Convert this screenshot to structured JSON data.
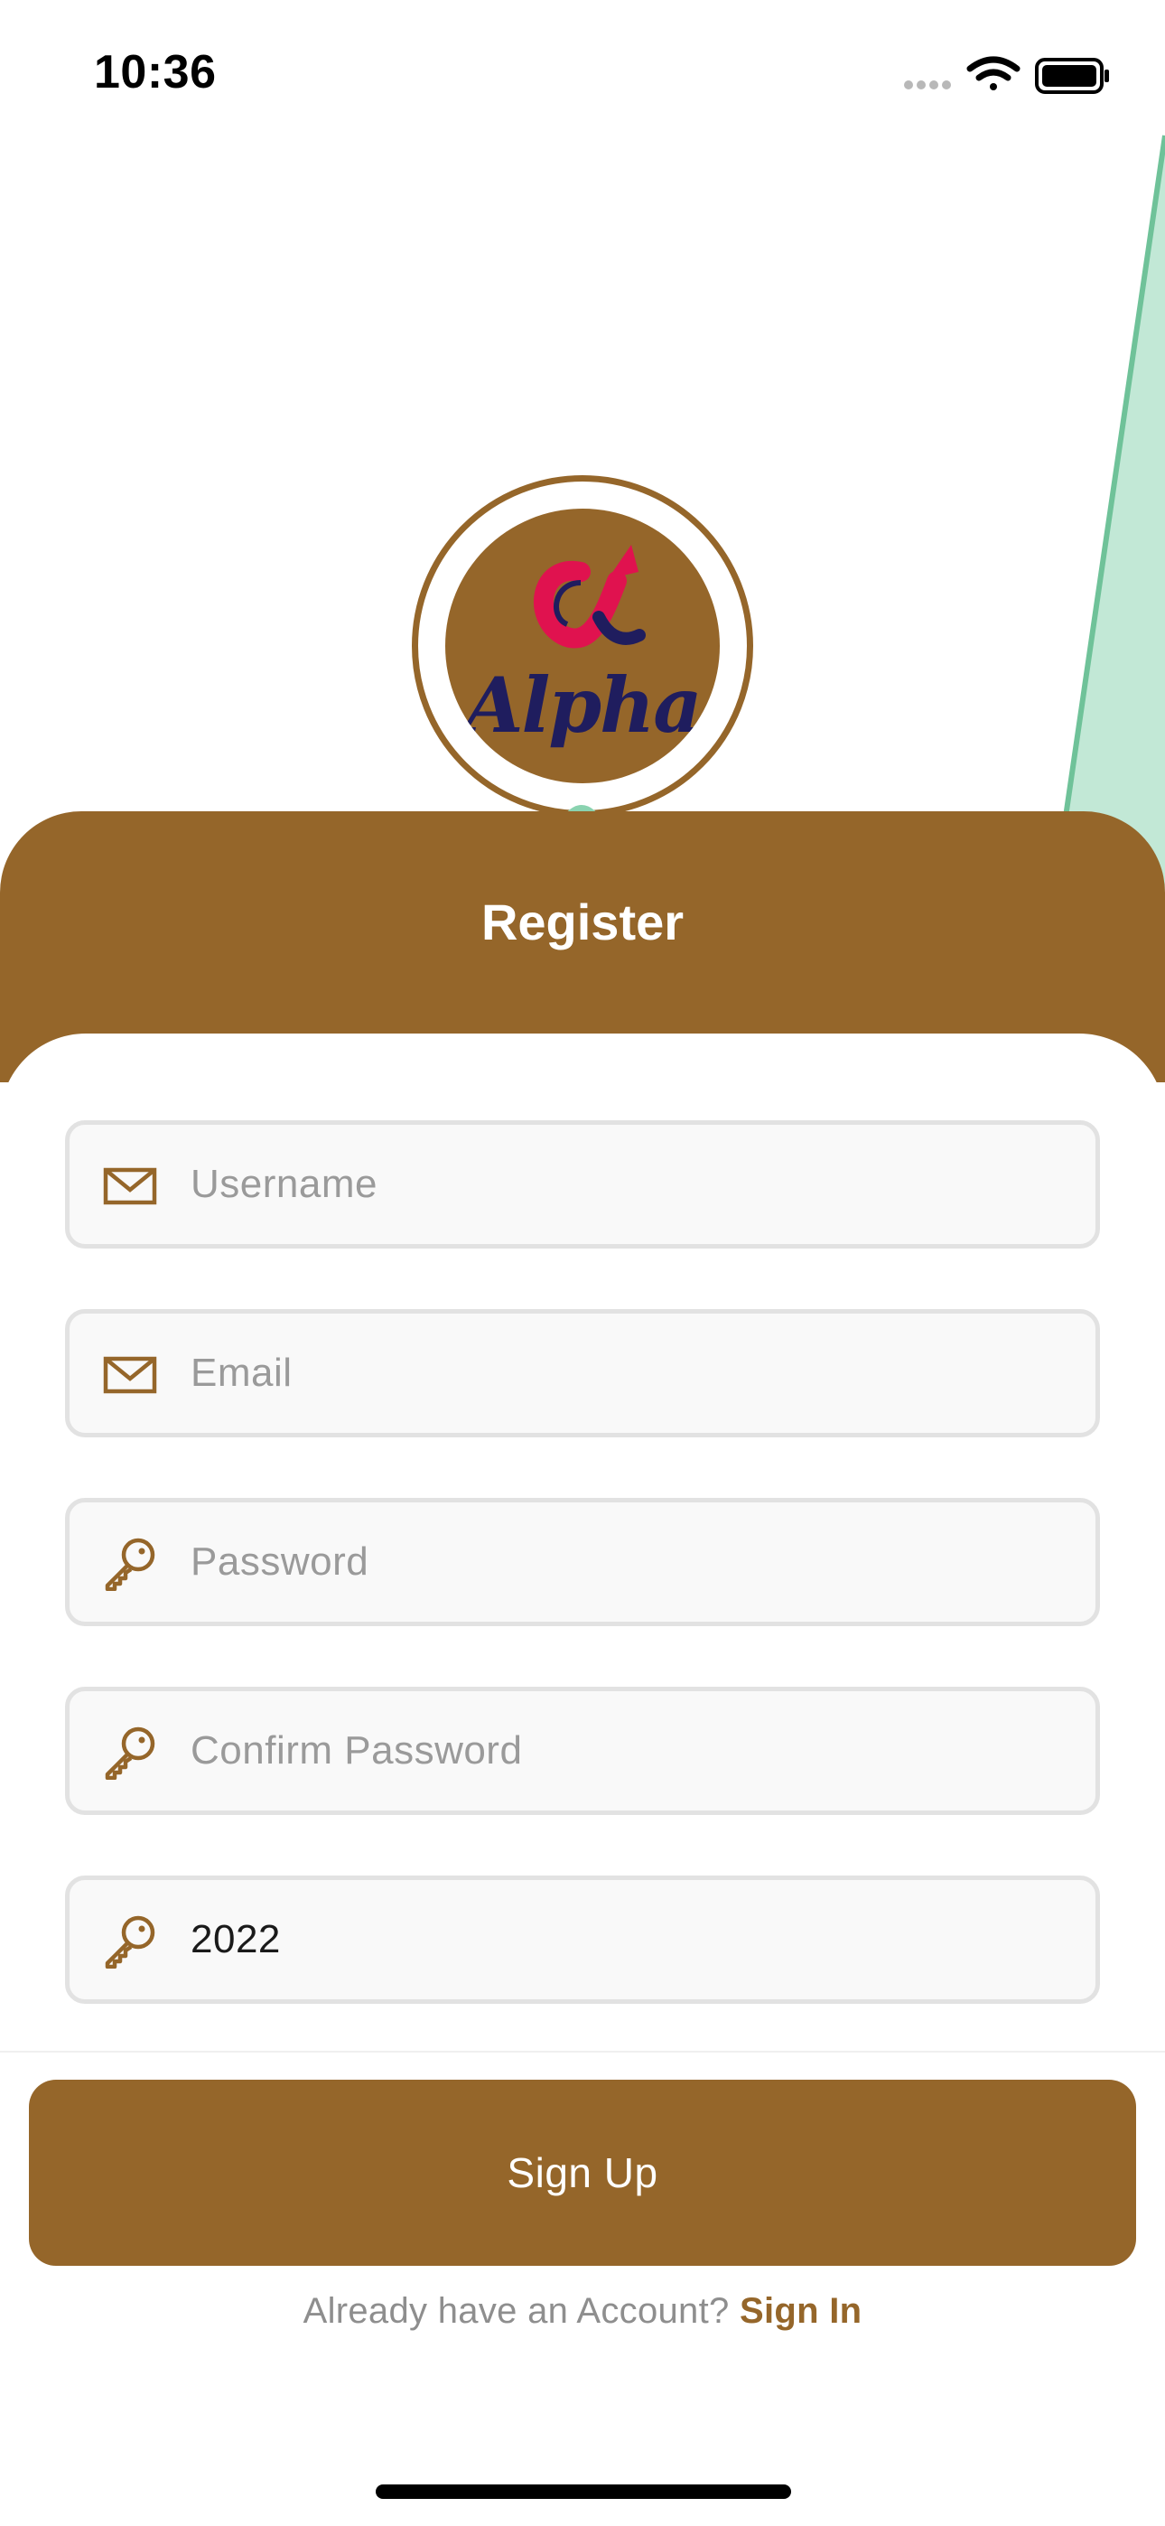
{
  "status_bar": {
    "time": "10:36",
    "icons": [
      "signal-icon",
      "wifi-icon",
      "battery-icon"
    ]
  },
  "logo": {
    "wordmark": "Alpha",
    "icon": "alpha-logo-icon"
  },
  "header": {
    "title": "Register"
  },
  "form": {
    "fields": [
      {
        "name": "username",
        "icon": "mail-icon",
        "placeholder": "Username",
        "value": ""
      },
      {
        "name": "email",
        "icon": "mail-icon",
        "placeholder": "Email",
        "value": ""
      },
      {
        "name": "password",
        "icon": "key-icon",
        "placeholder": "Password",
        "value": ""
      },
      {
        "name": "confirm-password",
        "icon": "key-icon",
        "placeholder": "Confirm Password",
        "value": ""
      },
      {
        "name": "code",
        "icon": "key-icon",
        "placeholder": "",
        "value": "2022"
      }
    ]
  },
  "actions": {
    "signup_label": "Sign Up",
    "signin_prompt": "Already have an Account?",
    "signin_label": "Sign In"
  },
  "colors": {
    "brand": "#95662a",
    "accent_green": "#c2e8d6",
    "logo_red": "#e0124f",
    "logo_navy": "#1f1d5e"
  }
}
